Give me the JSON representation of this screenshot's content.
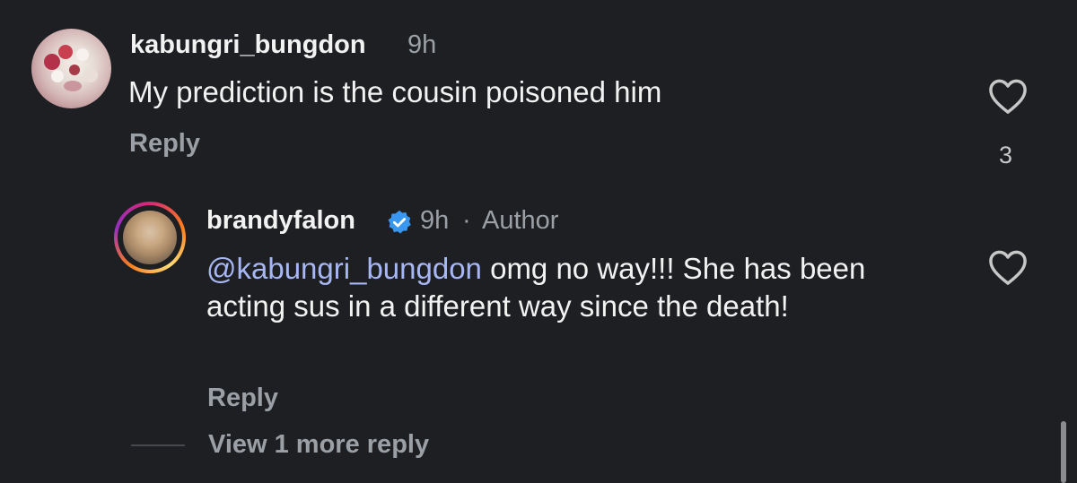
{
  "comments": [
    {
      "username": "kabungri_bungdon",
      "time": "9h",
      "text": "My prediction is the cousin poisoned him",
      "reply_label": "Reply",
      "like_count": "3"
    },
    {
      "username": "brandyfalon",
      "time": "9h",
      "separator": "·",
      "author_badge": "Author",
      "mention": "@kabungri_bungdon",
      "text": " omg no way!!! She has been acting sus in a different way since the death!",
      "reply_label": "Reply"
    }
  ],
  "view_more_label": "View 1 more reply",
  "icons": {
    "like": "heart-icon",
    "verified": "verified-badge-icon"
  },
  "colors": {
    "background": "#1e1f23",
    "mention": "#a7b7f5",
    "verified": "#3897f0",
    "muted": "#9aa0a6"
  }
}
